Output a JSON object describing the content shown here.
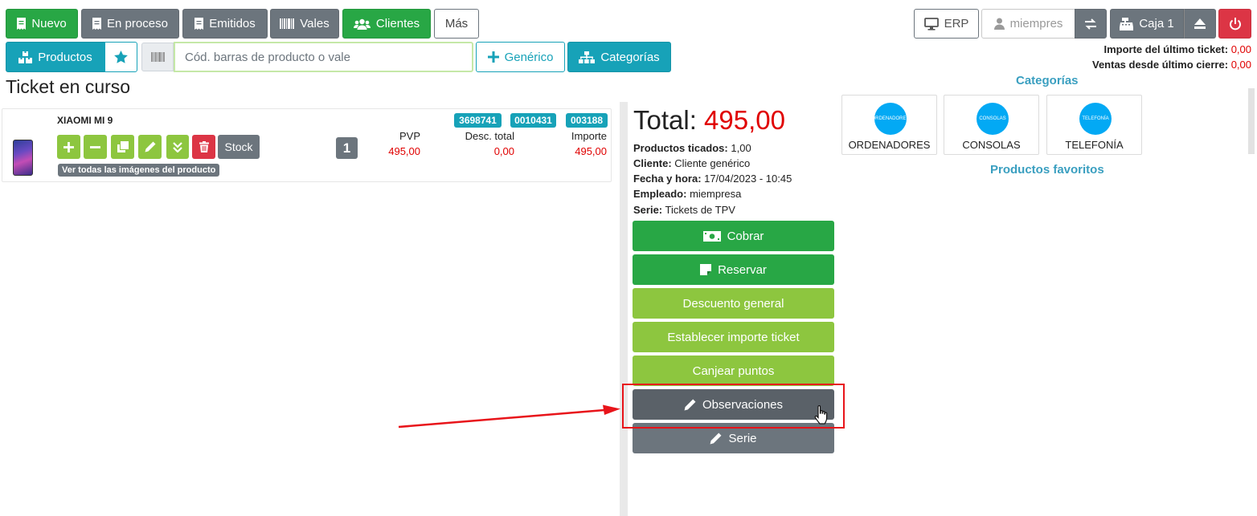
{
  "toolbar": {
    "nuevo": "Nuevo",
    "en_proceso": "En proceso",
    "emitidos": "Emitidos",
    "vales": "Vales",
    "clientes": "Clientes",
    "mas": "Más",
    "erp": "ERP",
    "user": "miempres",
    "caja": "Caja 1"
  },
  "row2": {
    "productos": "Productos",
    "search_placeholder": "Cód. barras de producto o vale",
    "generico": "Genérico",
    "categorias": "Categorías"
  },
  "summary": {
    "last_ticket_label": "Importe del último ticket:",
    "last_ticket_value": "0,00",
    "sales_label": "Ventas desde último cierre:",
    "sales_value": "0,00"
  },
  "ticket": {
    "title": "Ticket en curso",
    "product_name": "XIAOMI MI 9",
    "stock_label": "Stock",
    "images_link": "Ver todas las imágenes del producto",
    "quantity": "1",
    "codes": [
      "3698741",
      "0010431",
      "003188"
    ],
    "col_pvp": "PVP",
    "col_desc": "Desc. total",
    "col_importe": "Importe",
    "pvp": "495,00",
    "desc": "0,00",
    "importe": "495,00"
  },
  "totals": {
    "total_label": "Total:",
    "total_value": "495,00",
    "lines": [
      {
        "label": "Productos ticados:",
        "value": "1,00"
      },
      {
        "label": "Cliente:",
        "value": "Cliente genérico"
      },
      {
        "label": "Fecha y hora:",
        "value": "17/04/2023 - 10:45"
      },
      {
        "label": "Empleado:",
        "value": "miempresa"
      },
      {
        "label": "Serie:",
        "value": "Tickets de TPV"
      }
    ]
  },
  "actions": {
    "cobrar": "Cobrar",
    "reservar": "Reservar",
    "descuento": "Descuento general",
    "establecer": "Establecer importe ticket",
    "canjear": "Canjear puntos",
    "observaciones": "Observaciones",
    "serie": "Serie"
  },
  "categories": {
    "title": "Categorías",
    "favorites_title": "Productos favoritos",
    "items": [
      {
        "label": "ORDENADORES",
        "badge": "ORDENADORES"
      },
      {
        "label": "CONSOLAS",
        "badge": "CONSOLAS"
      },
      {
        "label": "TELEFONÍA",
        "badge": "TELEFONÍA"
      }
    ]
  },
  "colors": {
    "green": "#28a745",
    "teal": "#17a2b8",
    "lime": "#8dc63f",
    "gray": "#6c757d",
    "red": "#dc3545",
    "annotation_red": "#e8141a"
  }
}
